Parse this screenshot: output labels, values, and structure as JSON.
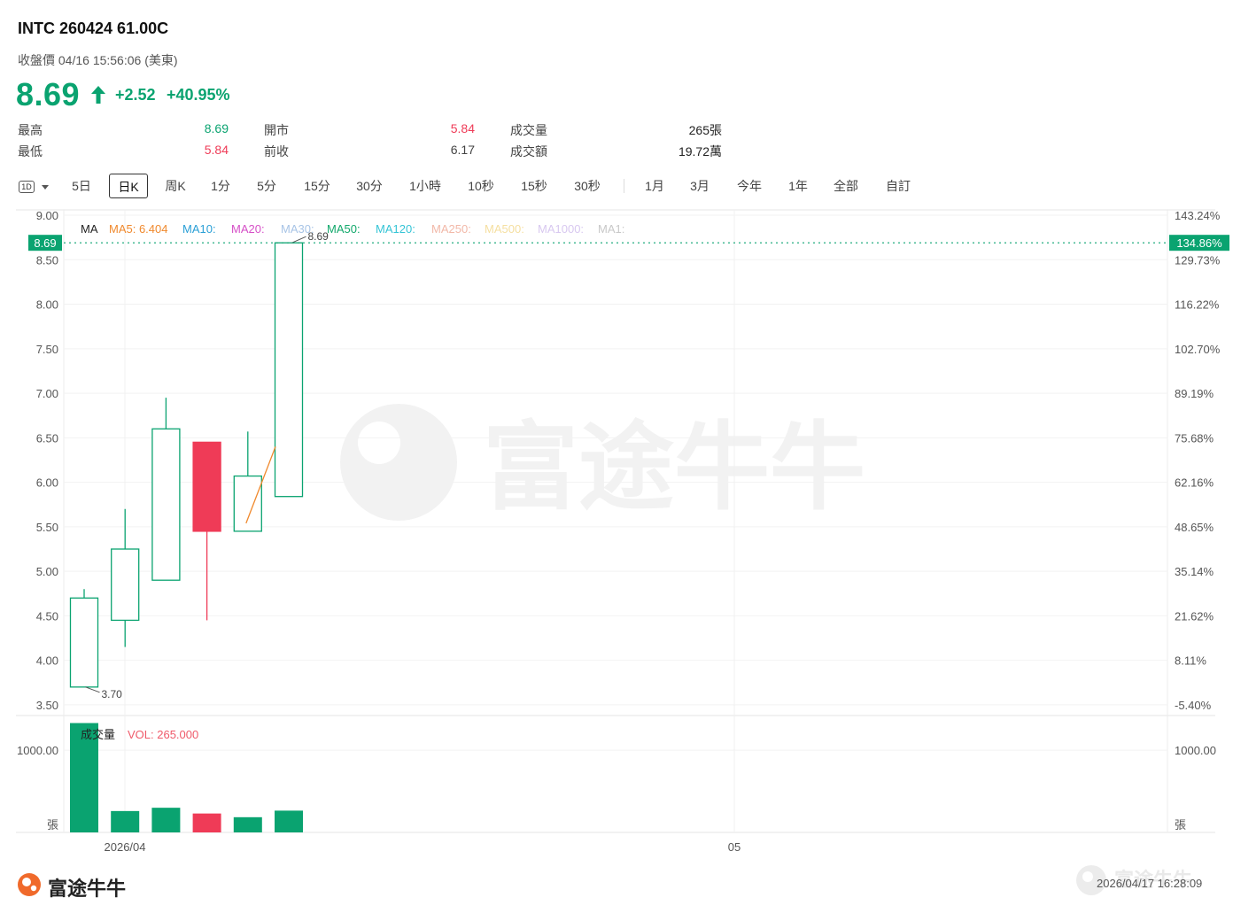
{
  "header": {
    "title": "INTC 260424 61.00C",
    "subtitle": "收盤價 04/16 15:56:06 (美東)",
    "price": "8.69",
    "change": "+2.52",
    "change_pct": "+40.95%"
  },
  "stats": {
    "high_label": "最高",
    "high_value": "8.69",
    "low_label": "最低",
    "low_value": "5.84",
    "open_label": "開市",
    "open_value": "5.84",
    "prev_close_label": "前收",
    "prev_close_value": "6.17",
    "volume_label": "成交量",
    "volume_value": "265張",
    "turnover_label": "成交額",
    "turnover_value": "19.72萬"
  },
  "tabs": {
    "interval_selector": "1D",
    "items": [
      "5日",
      "日K",
      "周K",
      "1分",
      "5分",
      "15分",
      "30分",
      "1小時",
      "10秒",
      "15秒",
      "30秒",
      "1月",
      "3月",
      "今年",
      "1年",
      "全部",
      "自訂"
    ],
    "active": "日K"
  },
  "ma_legend": {
    "title": "MA",
    "items": [
      {
        "label": "MA5: 6.404",
        "color": "#f0892d"
      },
      {
        "label": "MA10:",
        "color": "#2a9fd6"
      },
      {
        "label": "MA20:",
        "color": "#d64fc7"
      },
      {
        "label": "MA30:",
        "color": "#a8c4e6"
      },
      {
        "label": "MA50:",
        "color": "#12a86b"
      },
      {
        "label": "MA120:",
        "color": "#35c4d6"
      },
      {
        "label": "MA250:",
        "color": "#f2b8a8"
      },
      {
        "label": "MA500:",
        "color": "#f5dfa0"
      },
      {
        "label": "MA1000:",
        "color": "#d8c8f0"
      },
      {
        "label": "MA1:",
        "color": "#c8c8c8"
      }
    ]
  },
  "volume_legend": {
    "title": "成交量",
    "value": "VOL: 265.000",
    "value_color": "#ef5a6a"
  },
  "chart_data": {
    "type": "candlestick",
    "price_axis": {
      "ticks": [
        9.0,
        8.5,
        8.0,
        7.5,
        7.0,
        6.5,
        6.0,
        5.5,
        5.0,
        4.5,
        4.0,
        3.5
      ],
      "tick_labels": [
        "9.00",
        "8.50",
        "8.00",
        "7.50",
        "7.00",
        "6.50",
        "6.00",
        "5.50",
        "5.00",
        "4.50",
        "4.00",
        "3.50"
      ],
      "pct_labels": [
        "143.24%",
        "129.73%",
        "116.22%",
        "102.70%",
        "89.19%",
        "75.68%",
        "62.16%",
        "48.65%",
        "35.14%",
        "21.62%",
        "8.11%",
        "-5.40%"
      ],
      "ylim": [
        3.38,
        9.05
      ]
    },
    "current_price": {
      "label": "8.69",
      "pct_label": "134.86%",
      "value": 8.69
    },
    "candles": [
      {
        "open": 3.7,
        "high": 4.8,
        "low": 3.7,
        "close": 4.7
      },
      {
        "open": 4.45,
        "high": 5.7,
        "low": 4.15,
        "close": 5.25
      },
      {
        "open": 4.9,
        "high": 6.95,
        "low": 4.9,
        "close": 6.6
      },
      {
        "open": 6.45,
        "high": 6.45,
        "low": 4.45,
        "close": 5.45
      },
      {
        "open": 5.45,
        "high": 6.57,
        "low": 5.45,
        "close": 6.07
      },
      {
        "open": 5.84,
        "high": 8.69,
        "low": 5.84,
        "close": 8.69
      }
    ],
    "ma5": [
      null,
      null,
      null,
      null,
      5.58,
      6.4
    ],
    "annotations": [
      {
        "label": "3.70",
        "candle_index": 0,
        "value": 3.7
      },
      {
        "label": "8.69",
        "candle_index": 5,
        "value": 8.69
      }
    ],
    "volume": {
      "values": [
        1330,
        260,
        300,
        230,
        185,
        265
      ],
      "colors": [
        "up",
        "up",
        "up",
        "down",
        "up",
        "up"
      ],
      "ylim": [
        0,
        1400
      ],
      "tick": 1000,
      "tick_label": "1000.00",
      "unit": "張"
    },
    "x_labels": [
      {
        "label": "2026/04"
      },
      {
        "label": "05"
      }
    ],
    "up_color": "#0aa370",
    "down_color": "#ef3b57",
    "watermark": "富途牛牛"
  },
  "footer": {
    "brand": "富途牛牛",
    "timestamp": "2026/04/17 16:28:09"
  }
}
